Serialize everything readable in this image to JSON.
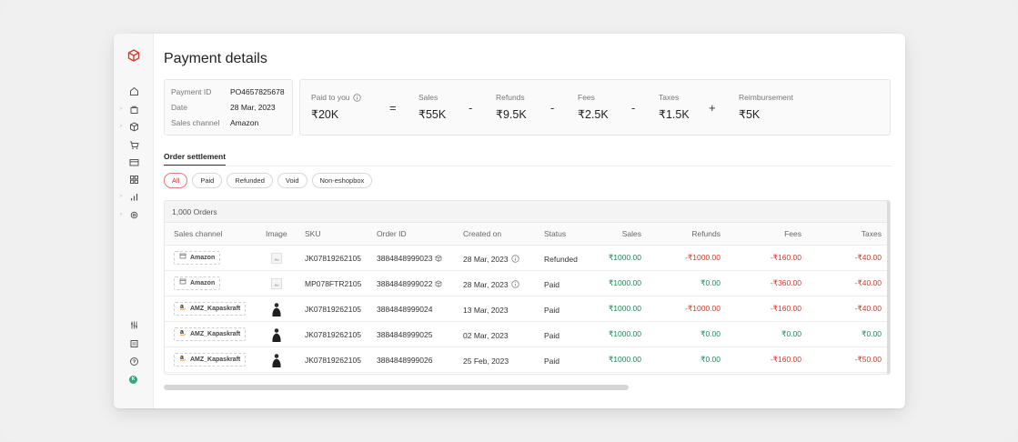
{
  "page": {
    "title": "Payment details"
  },
  "sidebar": {
    "logo": "box-logo-icon",
    "nav_icons": [
      "home-icon",
      "bag-icon",
      "cube-icon",
      "cart-icon",
      "card-icon",
      "grid-icon",
      "bar-chart-icon",
      "gear-icon"
    ],
    "bottom_icons": [
      "sliders-icon",
      "document-icon",
      "help-icon"
    ],
    "avatar_letter": "K"
  },
  "meta": {
    "payment_id_label": "Payment ID",
    "payment_id": "PO4657825678",
    "date_label": "Date",
    "date": "28 Mar, 2023",
    "channel_label": "Sales channel",
    "channel": "Amazon"
  },
  "summary": {
    "paid_label": "Paid to you",
    "paid": "₹20K",
    "sales_label": "Sales",
    "sales": "₹55K",
    "refunds_label": "Refunds",
    "refunds": "₹9.5K",
    "fees_label": "Fees",
    "fees": "₹2.5K",
    "taxes_label": "Taxes",
    "taxes": "₹1.5K",
    "reimb_label": "Reimbursement",
    "reimb": "₹5K",
    "ops": [
      "=",
      "-",
      "-",
      "-",
      "+"
    ]
  },
  "section": {
    "tab": "Order settlement"
  },
  "filters": [
    "All",
    "Paid",
    "Refunded",
    "Void",
    "Non-eshopbox"
  ],
  "active_filter": "All",
  "table": {
    "count": "1,000 Orders",
    "headers": {
      "channel": "Sales channel",
      "image": "Image",
      "sku": "SKU",
      "order": "Order ID",
      "created": "Created on",
      "status": "Status",
      "sales": "Sales",
      "refunds": "Refunds",
      "fees": "Fees",
      "taxes": "Taxes"
    },
    "rows": [
      {
        "channel": "Amazon",
        "channel_icon": "store-icon",
        "image": "placeholder",
        "sku": "JK07819262105",
        "order": "3884848999023",
        "order_icon": "cube-icon",
        "created": "28 Mar, 2023",
        "created_icon": "info-icon",
        "status": "Refunded",
        "sales": "₹1000.00",
        "refunds": "-₹1000.00",
        "fees": "-₹160.00",
        "taxes": "-₹40.00",
        "refunds_color": "red",
        "fees_color": "red",
        "taxes_color": "red"
      },
      {
        "channel": "Amazon",
        "channel_icon": "store-icon",
        "image": "placeholder",
        "sku": "MP078FTR2105",
        "order": "3884848999022",
        "order_icon": "cube-icon",
        "created": "28 Mar, 2023",
        "created_icon": "info-icon",
        "status": "Paid",
        "sales": "₹1000.00",
        "refunds": "₹0.00",
        "fees": "-₹360.00",
        "taxes": "-₹40.00",
        "refunds_color": "green",
        "fees_color": "red",
        "taxes_color": "red"
      },
      {
        "channel": "AMZ_Kapaskraft",
        "channel_icon": "amazon-icon",
        "image": "person",
        "sku": "JK07819262105",
        "order": "3884848999024",
        "order_icon": "",
        "created": "13 Mar, 2023",
        "created_icon": "",
        "status": "Paid",
        "sales": "₹1000.00",
        "refunds": "-₹1000.00",
        "fees": "-₹160.00",
        "taxes": "-₹40.00",
        "refunds_color": "red",
        "fees_color": "red",
        "taxes_color": "red"
      },
      {
        "channel": "AMZ_Kapaskraft",
        "channel_icon": "amazon-icon",
        "image": "person",
        "sku": "JK07819262105",
        "order": "3884848999025",
        "order_icon": "",
        "created": "02 Mar, 2023",
        "created_icon": "",
        "status": "Paid",
        "sales": "₹1000.00",
        "refunds": "₹0.00",
        "fees": "₹0.00",
        "taxes": "₹0.00",
        "refunds_color": "green",
        "fees_color": "green",
        "taxes_color": "green"
      },
      {
        "channel": "AMZ_Kapaskraft",
        "channel_icon": "amazon-icon",
        "image": "person",
        "sku": "JK07819262105",
        "order": "3884848999026",
        "order_icon": "",
        "created": "25 Feb, 2023",
        "created_icon": "",
        "status": "Paid",
        "sales": "₹1000.00",
        "refunds": "₹0.00",
        "fees": "-₹160.00",
        "taxes": "-₹50.00",
        "refunds_color": "green",
        "fees_color": "red",
        "taxes_color": "red"
      }
    ]
  },
  "colors": {
    "green": "#1e8a5a",
    "red": "#d23a2c",
    "accent": "#e07b6f"
  }
}
